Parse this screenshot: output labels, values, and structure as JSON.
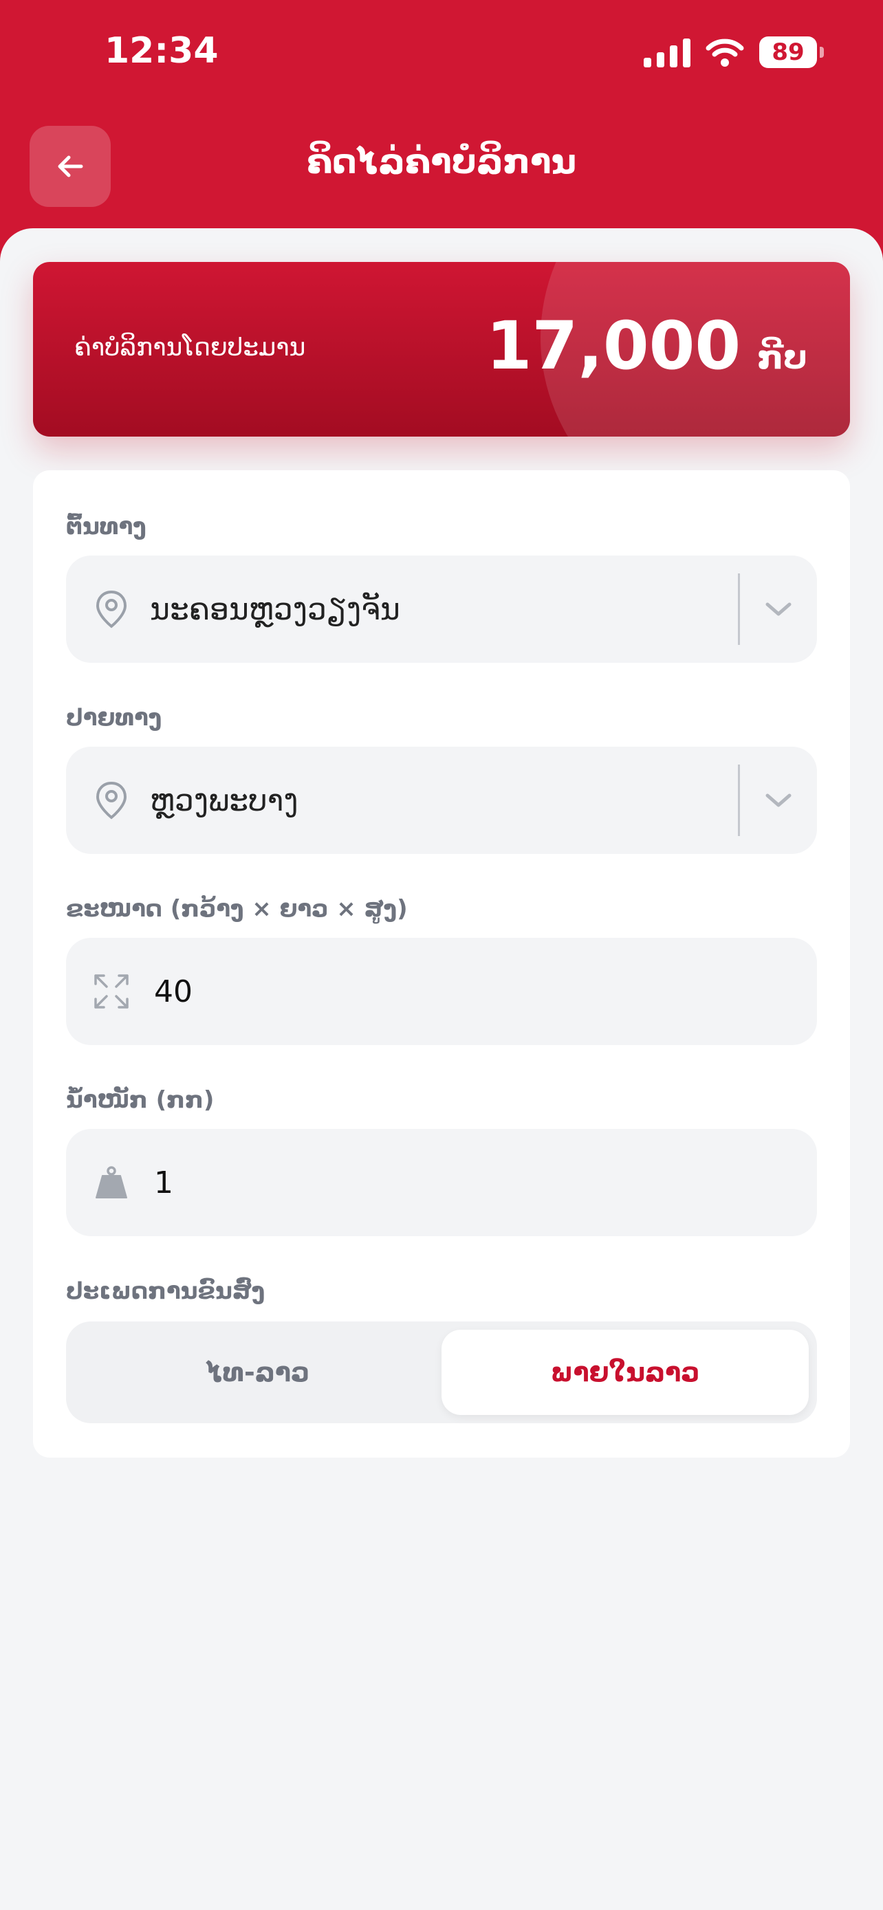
{
  "status_bar": {
    "time": "12:34",
    "battery": "89"
  },
  "header": {
    "title": "ຄິດໄລ່ຄ່າບໍລິການ"
  },
  "price_card": {
    "label": "ຄ່າບໍລິການໂດຍປະມານ",
    "amount": "17,000",
    "currency": "ກີບ"
  },
  "form": {
    "origin": {
      "label": "ຕົ້ນທາງ",
      "value": "ນະຄອນຫຼວງວຽງຈັນ"
    },
    "destination": {
      "label": "ປາຍທາງ",
      "value": "ຫຼວງພະບາງ"
    },
    "size": {
      "label": "ຂະໜາດ (ກວ້າງ × ຍາວ × ສູງ)",
      "value": "40"
    },
    "weight": {
      "label": "ນ້ຳໜັກ (ກກ)",
      "value": "1"
    },
    "shipping_type": {
      "label": "ປະເພດການຂົນສົ່ງ",
      "options": [
        "ໄທ-ລາວ",
        "ພາຍໃນລາວ"
      ],
      "selected": "ພາຍໃນລາວ"
    }
  },
  "colors": {
    "brand": "#d01733",
    "accent_text": "#c8102e",
    "field_bg": "#f3f4f6"
  }
}
